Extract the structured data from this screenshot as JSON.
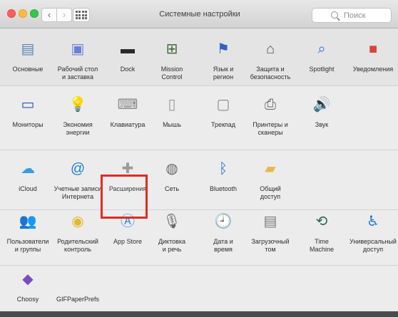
{
  "window": {
    "title": "Системные настройки",
    "nav_back": "‹",
    "nav_forward": "›",
    "search_placeholder": "Поиск"
  },
  "sections": [
    {
      "items": [
        {
          "id": "general",
          "label": "Основные",
          "icon": "file-icon",
          "glyph": "▤",
          "color": "#5a84b8"
        },
        {
          "id": "desktop",
          "label": "Рабочий стол\nи заставка",
          "icon": "desktop-screensaver-icon",
          "glyph": "▣",
          "color": "#6a7fd0"
        },
        {
          "id": "dock",
          "label": "Dock",
          "icon": "dock-icon",
          "glyph": "▬",
          "color": "#2a2a2a"
        },
        {
          "id": "mission",
          "label": "Mission\nControl",
          "icon": "mission-control-icon",
          "glyph": "⊞",
          "color": "#3b6e3b"
        },
        {
          "id": "language",
          "label": "Язык и\nрегион",
          "icon": "flag-icon",
          "glyph": "⚑",
          "color": "#2f63c7"
        },
        {
          "id": "security",
          "label": "Защита и\nбезопасность",
          "icon": "house-lock-icon",
          "glyph": "⌂",
          "color": "#555555"
        },
        {
          "id": "spotlight",
          "label": "Spotlight",
          "icon": "spotlight-icon",
          "glyph": "⌕",
          "color": "#2b7de0"
        },
        {
          "id": "notifications",
          "label": "Уведомления",
          "icon": "notifications-icon",
          "glyph": "■",
          "color": "#d9453c"
        }
      ]
    },
    {
      "items": [
        {
          "id": "displays",
          "label": "Мониторы",
          "icon": "monitor-icon",
          "glyph": "▭",
          "color": "#2c5b9e"
        },
        {
          "id": "energy",
          "label": "Экономия\nэнергии",
          "icon": "light-bulb-icon",
          "glyph": "💡",
          "color": "#e3c34b"
        },
        {
          "id": "keyboard",
          "label": "Клавиатура",
          "icon": "keyboard-icon",
          "glyph": "⌨",
          "color": "#8a8a8a"
        },
        {
          "id": "mouse",
          "label": "Мышь",
          "icon": "mouse-icon",
          "glyph": "▯",
          "color": "#9a9a9a"
        },
        {
          "id": "trackpad",
          "label": "Трекпад",
          "icon": "trackpad-icon",
          "glyph": "▢",
          "color": "#8a8a8a"
        },
        {
          "id": "printers",
          "label": "Принтеры и\nсканеры",
          "icon": "printer-icon",
          "glyph": "⎙",
          "color": "#666666"
        },
        {
          "id": "sound",
          "label": "Звук",
          "icon": "speaker-icon",
          "glyph": "🔊",
          "color": "#555555"
        }
      ]
    },
    {
      "items": [
        {
          "id": "icloud",
          "label": "iCloud",
          "icon": "cloud-icon",
          "glyph": "☁",
          "color": "#3a9be0"
        },
        {
          "id": "accounts",
          "label": "Учетные записи\nИнтернета",
          "icon": "at-sign-icon",
          "glyph": "@",
          "color": "#1f7fd6"
        },
        {
          "id": "extensions",
          "label": "Расширения",
          "icon": "puzzle-piece-icon",
          "glyph": "✚",
          "color": "#9a9a9a"
        },
        {
          "id": "network",
          "label": "Сеть",
          "icon": "globe-icon",
          "glyph": "◍",
          "color": "#6a6a6a"
        },
        {
          "id": "bluetooth",
          "label": "Bluetooth",
          "icon": "bluetooth-icon",
          "glyph": "ᛒ",
          "color": "#1f6fd0"
        },
        {
          "id": "sharing",
          "label": "Общий\nдоступ",
          "icon": "shared-folder-icon",
          "glyph": "▰",
          "color": "#e9b84a"
        }
      ]
    },
    {
      "items": [
        {
          "id": "users",
          "label": "Пользователи\nи группы",
          "icon": "users-icon",
          "glyph": "👥",
          "color": "#2a2a2a"
        },
        {
          "id": "parental",
          "label": "Родительский\nконтроль",
          "icon": "parental-control-icon",
          "glyph": "◉",
          "color": "#e3b82c"
        },
        {
          "id": "appstore",
          "label": "App Store",
          "icon": "app-store-icon",
          "glyph": "Ⓐ",
          "color": "#2d8ef0"
        },
        {
          "id": "dictation",
          "label": "Диктовка\nи речь",
          "icon": "microphone-icon",
          "glyph": "🎙",
          "color": "#666666"
        },
        {
          "id": "datetime",
          "label": "Дата и\nвремя",
          "icon": "clock-calendar-icon",
          "glyph": "🕘",
          "color": "#d9453c"
        },
        {
          "id": "startup",
          "label": "Загрузочный\nтом",
          "icon": "hard-drive-icon",
          "glyph": "▤",
          "color": "#7a7a7a"
        },
        {
          "id": "timemachine",
          "label": "Time\nMachine",
          "icon": "time-machine-icon",
          "glyph": "⟲",
          "color": "#2b6a5a"
        },
        {
          "id": "accessibility",
          "label": "Универсальный\nдоступ",
          "icon": "accessibility-icon",
          "glyph": "♿",
          "color": "#1f78d0"
        }
      ]
    },
    {
      "items": [
        {
          "id": "choosy",
          "label": "Choosy",
          "icon": "choosy-icon",
          "glyph": "◆",
          "color": "#7a4cc2"
        },
        {
          "id": "gifpaper",
          "label": "GIFPaperPrefs",
          "icon": "blank-icon",
          "glyph": "",
          "color": "#ececec"
        }
      ]
    }
  ]
}
